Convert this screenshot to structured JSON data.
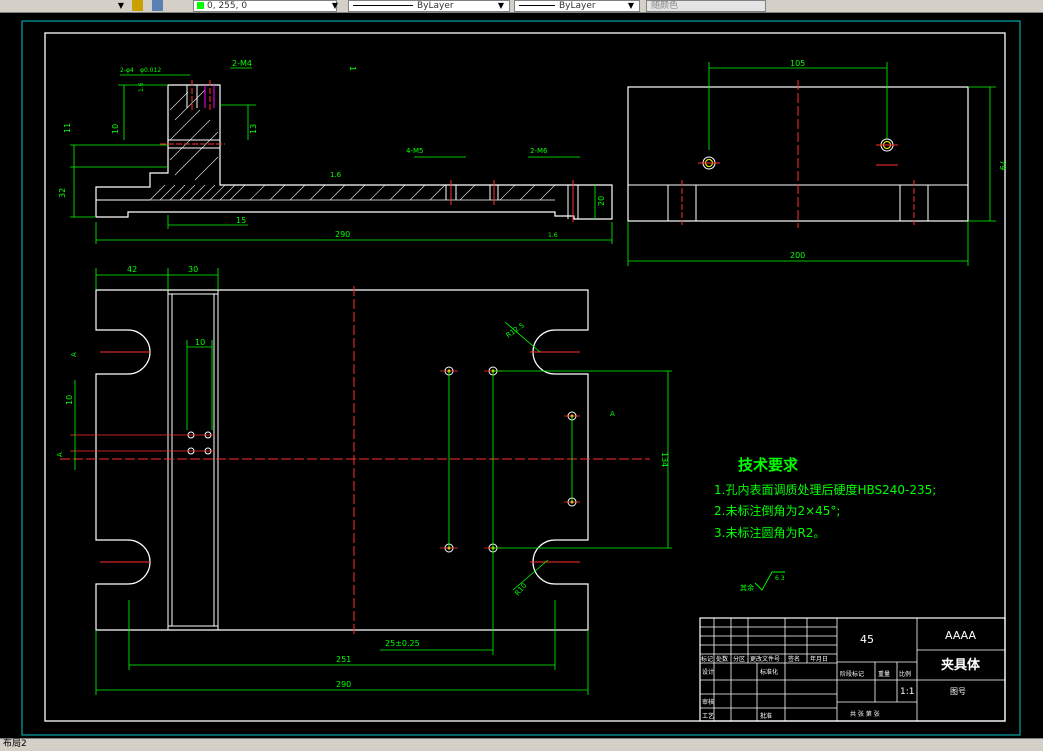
{
  "toolbar": {
    "color_value": "0, 255, 0",
    "linetype_value": "ByLayer",
    "lineweight_value": "ByLayer",
    "plotstyle_value": "随颜色"
  },
  "drawing": {
    "dims": {
      "d_2m4": "2-M4",
      "d_2phi4": "2-φ4",
      "d_phi012": "φ0.012",
      "d_11": "11",
      "d_10v": "10",
      "d_13": "13",
      "d_32": "32",
      "d_15": "15",
      "d_4m5": "4-M5",
      "d_2m6": "2-M6",
      "d_20": "20",
      "d_290_top": "290",
      "d_105": "105",
      "d_79": "79",
      "d_200": "200",
      "d_42": "42",
      "d_30": "30",
      "d_10h": "10",
      "d_10v2": "10",
      "d_r12": "R12.5",
      "d_r10": "R10",
      "d_134": "134",
      "d_25": "25±0.25",
      "d_251": "251",
      "d_290_bottom": "290",
      "rough_16a": "1.6",
      "rough_16b": "1.6",
      "rough_16c": "1.6",
      "rough_other": "6.3",
      "rough_prefix": "其余",
      "section_a": "A",
      "section_a2": "A",
      "section_a3": "A",
      "section_1": "1"
    },
    "tech_title": "技术要求",
    "tech_items": [
      "1.孔内表面调质处理后硬度HBS240-235;",
      "2.未标注倒角为2×45°;",
      "3.未标注圆角为R2。"
    ]
  },
  "title_block": {
    "material": "45",
    "company": "AAAA",
    "part_name": "夹具体",
    "scale_label": "比例",
    "scale_value": "1:1",
    "drawing_no_label": "图号",
    "weight_label": "重量",
    "stage_label": "阶段标记",
    "sheet_label": "共 张 第 张",
    "design_label": "设计",
    "standardize_label": "标准化",
    "review_label": "审核",
    "process_label": "工艺",
    "approve_label": "批准",
    "head_labels": [
      "标记",
      "处数",
      "分区",
      "更改文件号",
      "签名",
      "年月日"
    ]
  },
  "layout_tab": "布局2"
}
